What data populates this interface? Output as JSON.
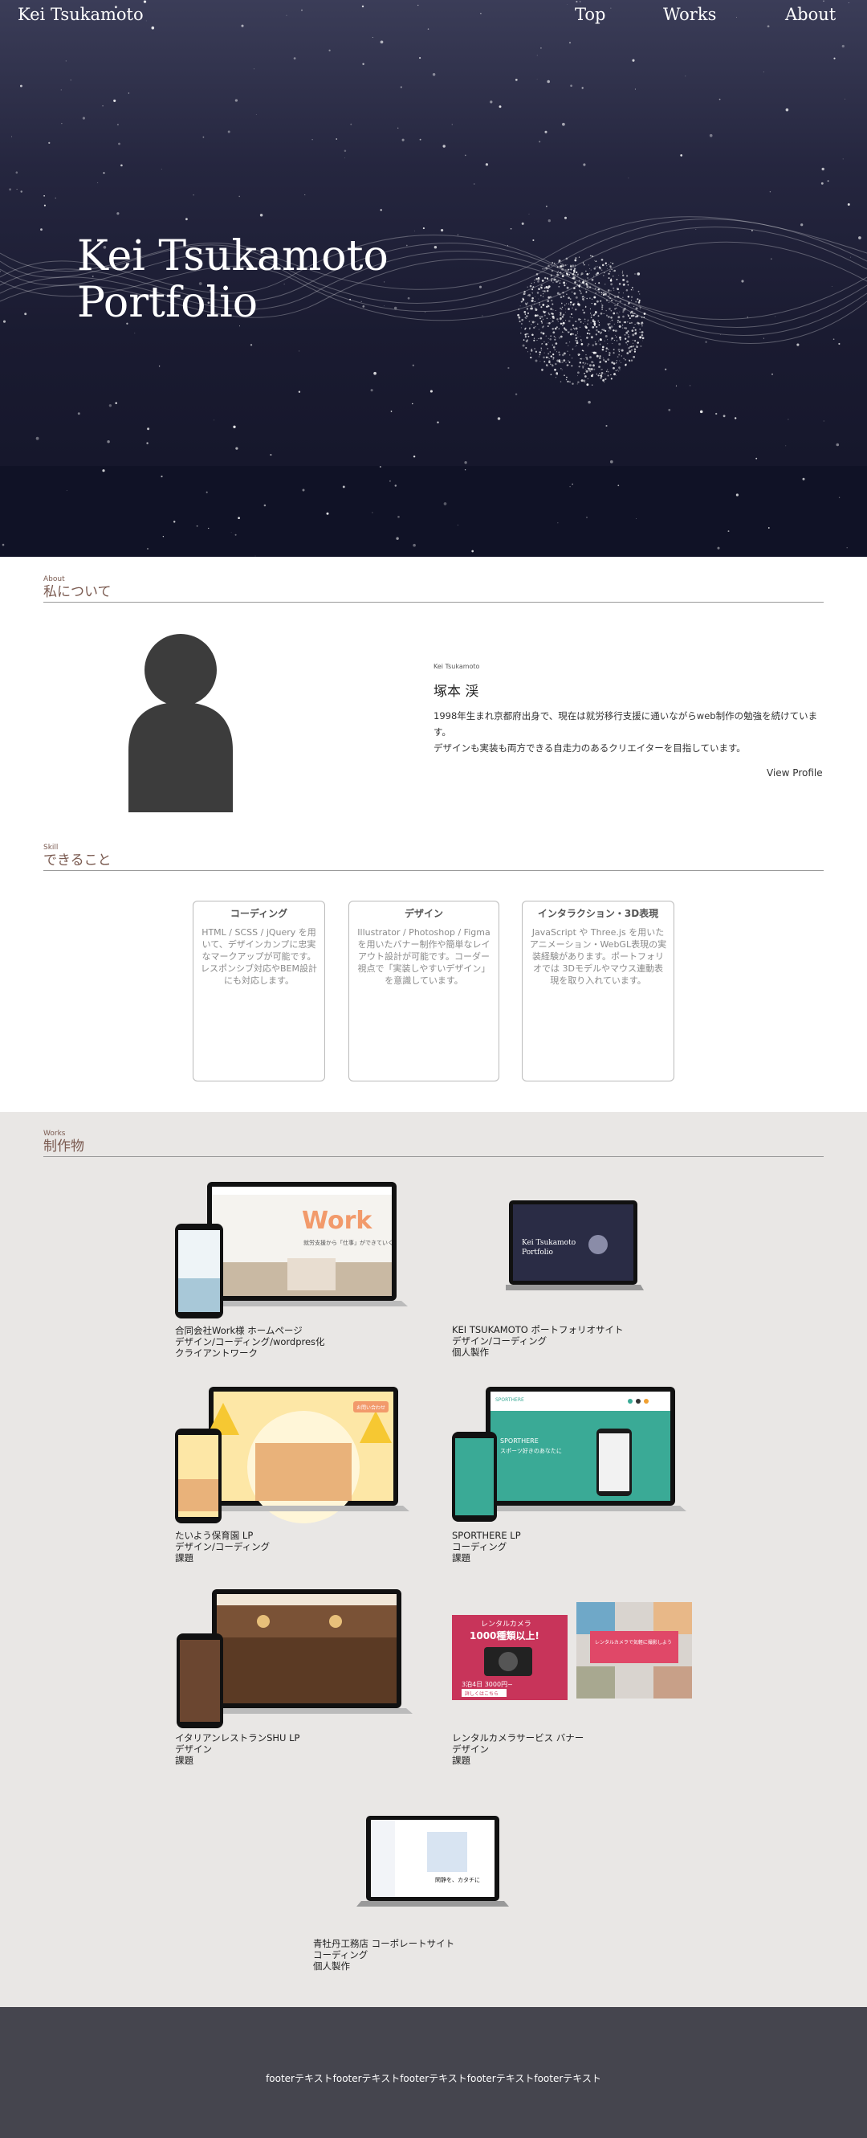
{
  "header": {
    "logo": "Kei Tsukamoto",
    "nav": [
      "Top",
      "Works",
      "About"
    ]
  },
  "hero": {
    "title_line1": "Kei Tsukamoto",
    "title_line2": "Portfolio"
  },
  "about": {
    "section_en": "About",
    "section_ja": "私について",
    "name_en": "Kei Tsukamoto",
    "name_ja": "塚本 渓",
    "description_line1": "1998年生まれ京都府出身で、現在は就労移行支援に通いながらweb制作の勉強を続けています。",
    "description_line2": "デザインも実装も両方できる自走力のあるクリエイターを目指しています。",
    "view_profile": "View Profile"
  },
  "skill": {
    "section_en": "Skill",
    "section_ja": "できること",
    "cards": [
      {
        "title": "コーディング",
        "body": "HTML / SCSS / jQuery を用いて、デザインカンプに忠実なマークアップが可能です。レスポンシブ対応やBEM設計にも対応します。"
      },
      {
        "title": "デザイン",
        "body": "Illustrator / Photoshop / Figma を用いたバナー制作や簡単なレイアウト設計が可能です。コーダー視点で「実装しやすいデザイン」を意識しています。"
      },
      {
        "title": "インタラクション・3D表現",
        "body": "JavaScript や Three.js を用いたアニメーション・WebGL表現の実装経験があります。ポートフォリオでは 3Dモデルやマウス連動表現を取り入れています。"
      }
    ]
  },
  "works": {
    "section_en": "Works",
    "section_ja": "制作物",
    "items": [
      {
        "title": "合同会社Work様 ホームページ",
        "role": "デザイン/コーディング/wordpres化",
        "type": "クライアントワーク"
      },
      {
        "title": "KEI TSUKAMOTO ポートフォリオサイト",
        "role": "デザイン/コーディング",
        "type": "個人製作"
      },
      {
        "title": "たいよう保育園 LP",
        "role": "デザイン/コーディング",
        "type": "課題"
      },
      {
        "title": "SPORTHERE LP",
        "role": "コーディング",
        "type": "課題"
      },
      {
        "title": "イタリアンレストランSHU LP",
        "role": "デザイン",
        "type": "課題"
      },
      {
        "title": "レンタルカメラサービス バナー",
        "role": "デザイン",
        "type": "課題"
      },
      {
        "title": "青牡丹工務店 コーポレートサイト",
        "role": "コーディング",
        "type": "個人製作"
      }
    ],
    "thumb_text": {
      "work_logo": "Work",
      "work_tagline": "就労支援から「仕事」ができていく",
      "portfolio_line1": "Kei Tsukamoto",
      "portfolio_line2": "Portfolio",
      "taiyo_badge": "お問い合わせ",
      "sporthere_brand": "SPORTHERE",
      "sporthere_head1": "SPORTHERE",
      "sporthere_head2": "スポーツ好きのあなたに",
      "camera_head1": "レンタルカメラ",
      "camera_head2": "1000種類以上!",
      "camera_price": "3泊4日 3000円~",
      "camera_cta": "詳しくはこちら",
      "camera2_head": "レンタルカメラで気軽に撮影しよう",
      "aobotan_head": "閑静を、カタチに"
    }
  },
  "footer": {
    "text": "footerテキストfooterテキストfooterテキストfooterテキストfooterテキスト"
  },
  "colors": {
    "hero_top": "#3b3d58",
    "hero_bottom": "#131428",
    "accent_brown": "#7a5a50",
    "works_bg": "#e9e7e5",
    "footer_bg": "#45454e"
  }
}
